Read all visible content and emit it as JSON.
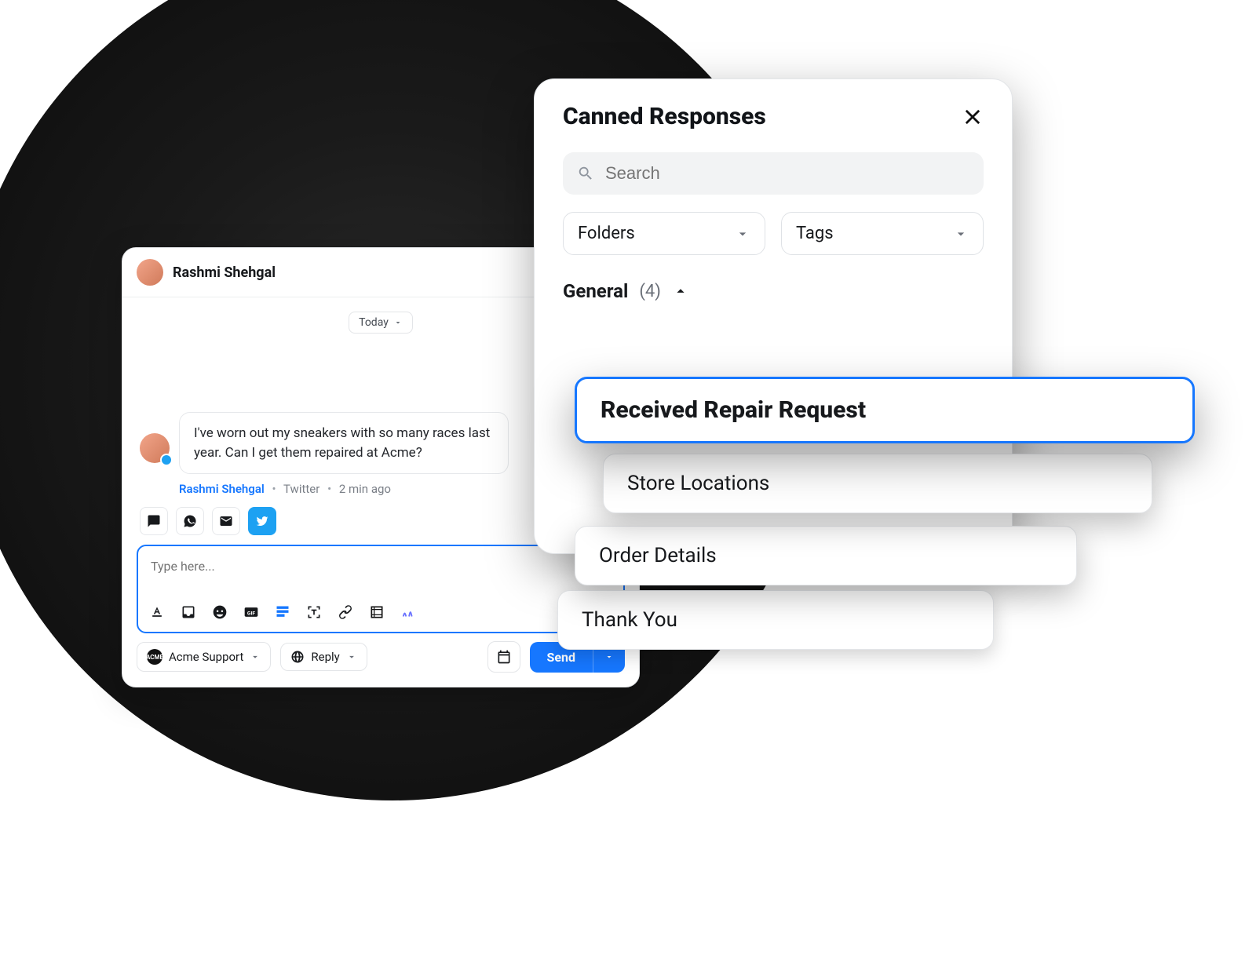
{
  "chat": {
    "contact_name": "Rashmi Shehgal",
    "date_label": "Today",
    "message": {
      "text": "I've worn out my sneakers with so many races last year. Can I get them repaired at Acme?",
      "author": "Rashmi Shehgal",
      "channel": "Twitter",
      "time": "2 min ago"
    },
    "composer": {
      "placeholder": "Type here...",
      "from_label": "Acme Support",
      "reply_mode": "Reply",
      "send_label": "Send"
    }
  },
  "canned": {
    "title": "Canned Responses",
    "search_placeholder": "Search",
    "filters": {
      "folders": "Folders",
      "tags": "Tags"
    },
    "group": {
      "name": "General",
      "count": "(4)"
    },
    "items": [
      "Received Repair Request",
      "Store Locations",
      "Order Details",
      "Thank You"
    ]
  }
}
